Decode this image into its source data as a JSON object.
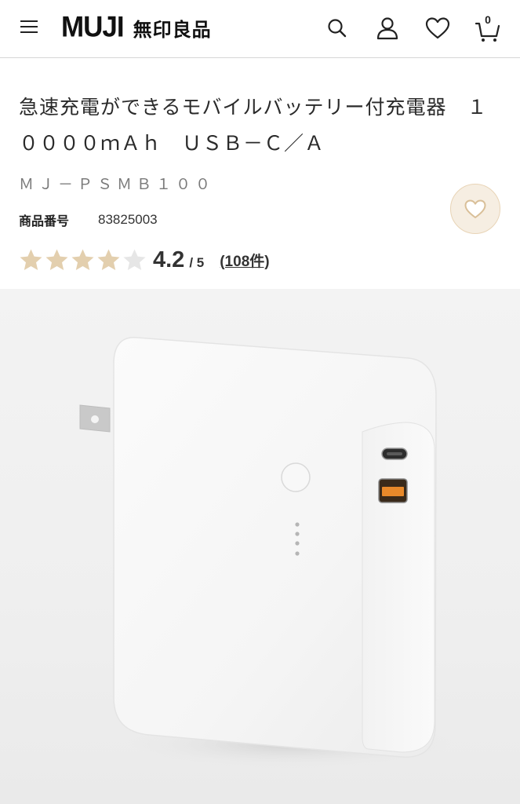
{
  "header": {
    "logo_en": "MUJI",
    "logo_jp": "無印良品",
    "cart_count": "0",
    "icons": [
      "menu-icon",
      "search-icon",
      "account-icon",
      "heart-icon",
      "cart-icon"
    ]
  },
  "product": {
    "title": "急速充電ができるモバイルバッテリー付充電器　１００００ｍＡｈ　ＵＳＢ－Ｃ／Ａ",
    "model": "ＭＪ－ＰＳＭＢ１００",
    "number_label": "商品番号",
    "number_value": "83825003",
    "rating": {
      "value": 4.2,
      "max": 5,
      "score_text": "4.2",
      "outof_text": "/ 5",
      "reviews_text": "(108件)",
      "filled_stars": 4
    }
  },
  "colors": {
    "star_filled": "#e3cfae",
    "star_empty": "#e6e6e6",
    "fav_bg": "#f6eee2",
    "fav_border": "#e8d4b6",
    "usb_a_port": "#e8892a"
  }
}
